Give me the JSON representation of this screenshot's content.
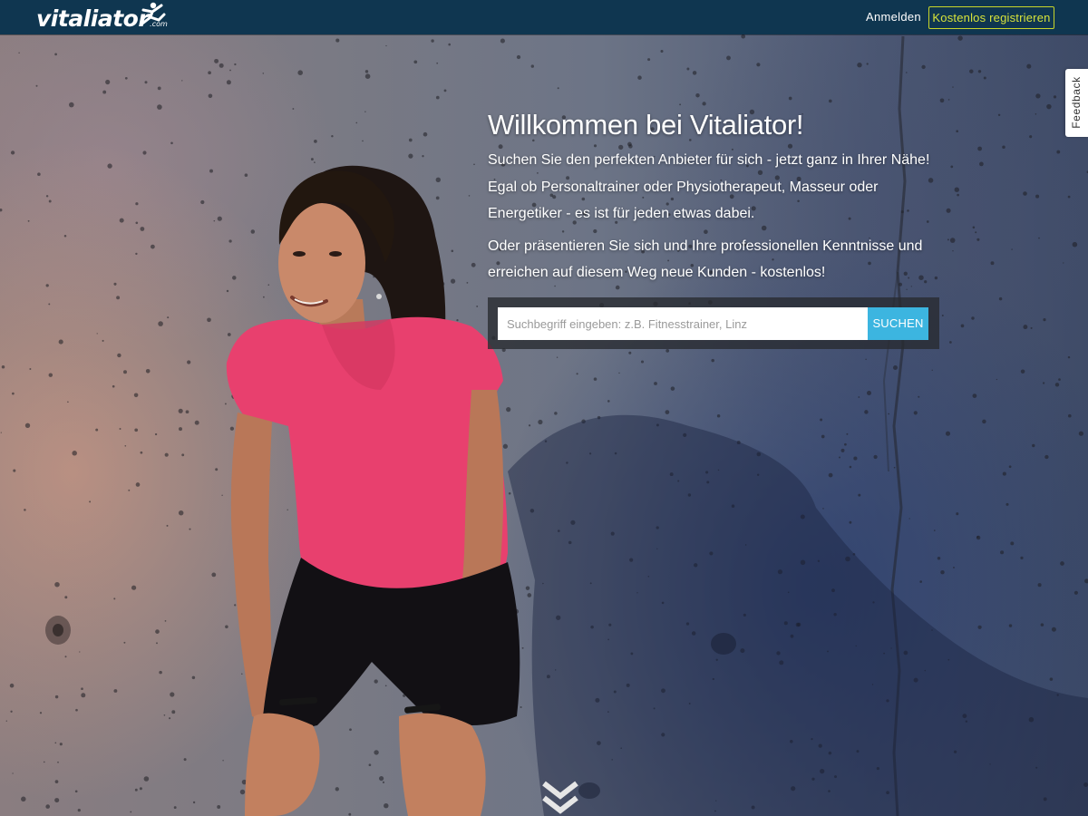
{
  "header": {
    "logo_text": "vitaliator",
    "logo_suffix": ".com",
    "login_label": "Anmelden",
    "register_label": "Kostenlos registrieren"
  },
  "feedback": {
    "label": "Feedback"
  },
  "hero": {
    "title": "Willkommen bei Vitaliator!",
    "paragraph_1": "Suchen Sie den perfekten Anbieter für sich - jetzt ganz in Ihrer Nähe! Egal ob Personaltrainer oder Physiotherapeut, Masseur oder Energetiker - es ist für jeden etwas dabei.",
    "paragraph_2": "Oder präsentieren Sie sich und Ihre professionellen Kenntnisse und erreichen auf diesem Weg neue Kunden - kostenlos!"
  },
  "search": {
    "placeholder": "Suchbegriff eingeben: z.B. Fitnesstrainer, Linz",
    "value": "",
    "button_label": "SUCHEN"
  },
  "icons": {
    "logo_figure": "running-figure-icon",
    "scroll": "double-chevron-down-icon"
  },
  "colors": {
    "nav_background": "#0f3650",
    "register_accent": "#d7e33a",
    "search_button": "#3cb5e0",
    "shirt": "#e8406e"
  }
}
